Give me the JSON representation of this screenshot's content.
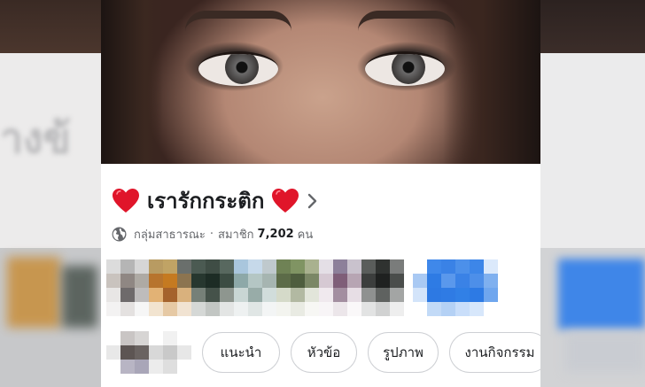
{
  "group": {
    "name": "เรารักกระติก",
    "privacy_label": "กลุ่มสาธารณะ",
    "separator": "·",
    "members_label": "สมาชิก",
    "member_count": "7,202",
    "member_unit": "คน"
  },
  "tabs": [
    {
      "label": "แนะนำ"
    },
    {
      "label": "หัวข้อ"
    },
    {
      "label": "รูปภาพ"
    },
    {
      "label": "งานกิจกรรม"
    }
  ],
  "icons": {
    "heart": "heart-icon",
    "chevron": "chevron-right-icon",
    "globe": "globe-icon"
  },
  "colors": {
    "heart": "#e0152a",
    "text_primary": "#1c1e21",
    "text_secondary": "#65676b",
    "tab_border": "#ced0d4"
  }
}
